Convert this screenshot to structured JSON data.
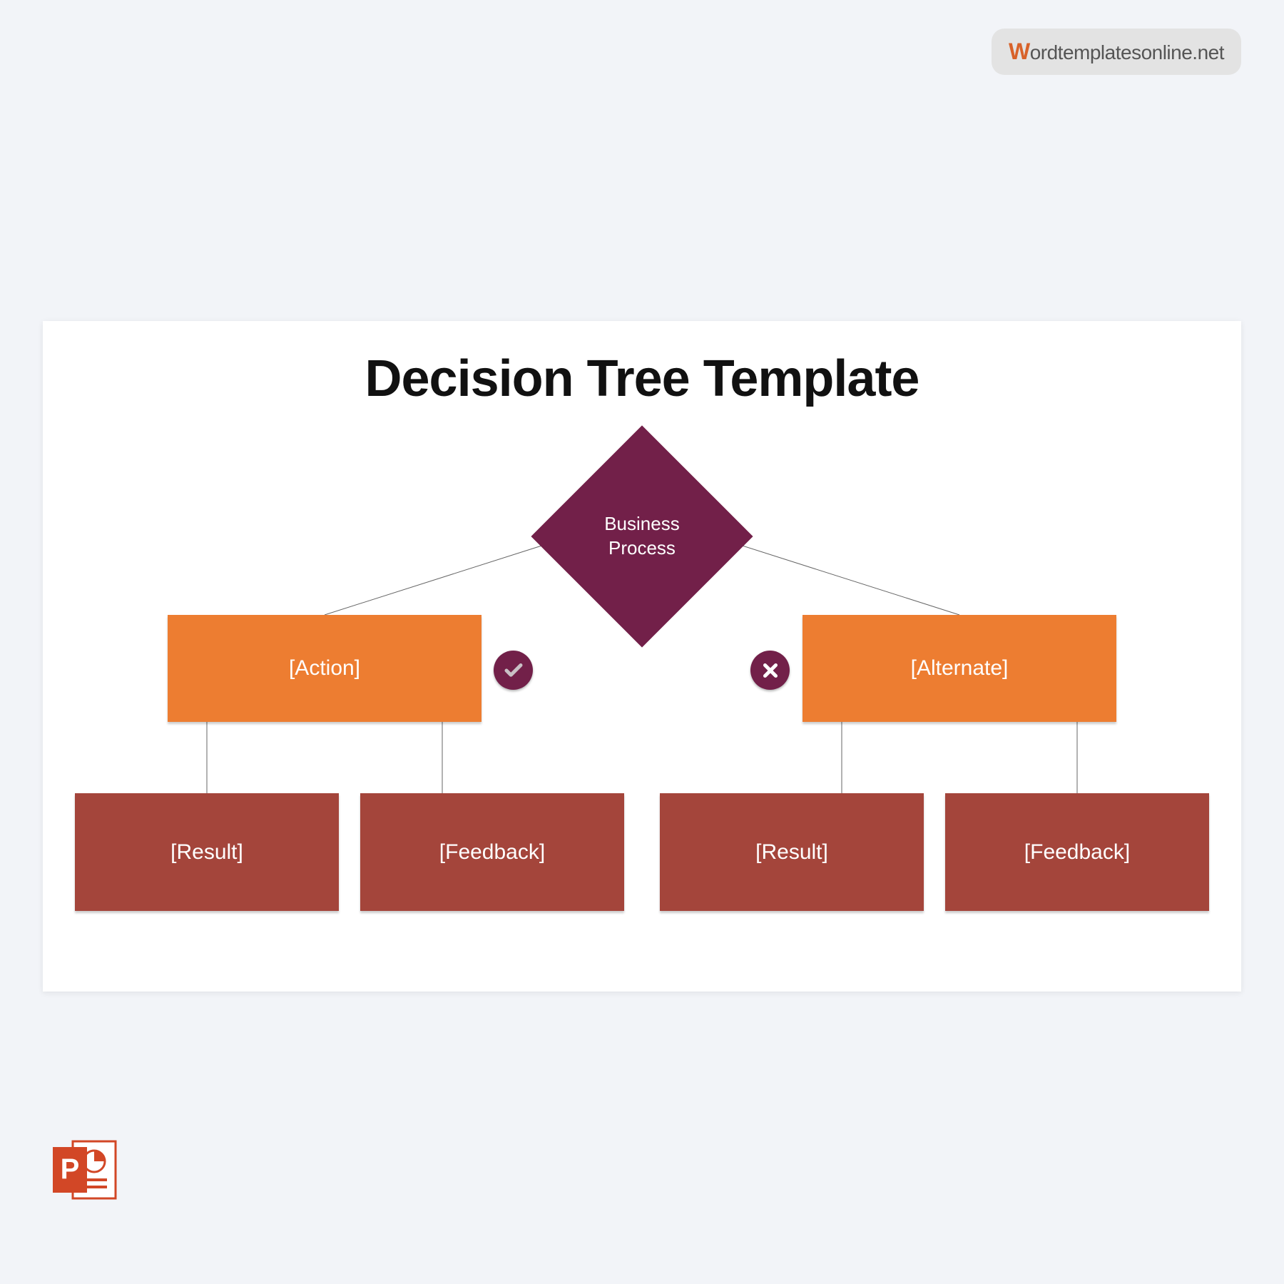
{
  "watermark": {
    "prefix": "W",
    "suffix": "ordtemplatesonline.net"
  },
  "slide": {
    "title": "Decision Tree Template"
  },
  "diagram": {
    "decision": "Business\nProcess",
    "action_left": "[Action]",
    "action_right": "[Alternate]",
    "badge_left": "check",
    "badge_right": "cross",
    "results": [
      "[Result]",
      "[Feedback]",
      "[Result]",
      "[Feedback]"
    ]
  },
  "colors": {
    "diamond": "#722049",
    "action": "#ed7d31",
    "result": "#a4453b",
    "badge": "#722049"
  }
}
